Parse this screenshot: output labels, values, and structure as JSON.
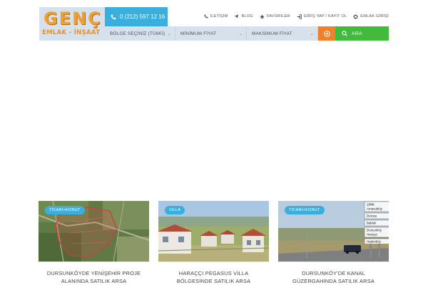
{
  "brand": {
    "logo_main": "GENÇ",
    "logo_sub": "EMLAK - İNŞAAT"
  },
  "header": {
    "phone": "0 (212) 597 12 16",
    "nav": [
      {
        "label": "İLETİŞİM",
        "icon": "phone-icon"
      },
      {
        "label": "BLOG",
        "icon": "send-icon"
      },
      {
        "label": "FAVORİLER",
        "icon": "star-icon"
      },
      {
        "label": "GİRİŞ YAP / KAYIT OL",
        "icon": "login-icon"
      },
      {
        "label": "EMLAK GİRİŞİ",
        "icon": "gear-icon"
      }
    ]
  },
  "search": {
    "region": "BÖLGE SEÇİNİZ (TÜMÜ)",
    "min_price": "MİNİMUM FİYAT",
    "max_price": "MAKSİMUM FİYAT",
    "button": "ARA"
  },
  "listings": [
    {
      "badge": "TİCARİ+KONUT",
      "title_line1": "DURSUNKÖYDE YENİŞEHİR PROJE",
      "title_line2": "ALANINDA SATILIK ARSA"
    },
    {
      "badge": "VİLLA",
      "title_line1": "HARAÇÇI PEGASUS VİLLA",
      "title_line2": "BÖLGESİNDE SATILIK ARSA"
    },
    {
      "badge": "TİCARİ+KONUT",
      "title_line1": "DURSUNKÖY'DE KANAL",
      "title_line2": "GÜZERGAHINDA SATILIK ARSA"
    }
  ],
  "sign": [
    "Çiftlik",
    "Arnavutköy",
    "Durusu",
    "Baklalı",
    "Dursunköy",
    "Haraççı",
    "Hadımköy"
  ],
  "colors": {
    "accent_blue": "#3aaedc",
    "orange": "#f0802a",
    "green": "#42bb3d",
    "search_bg": "#d7e1ec"
  }
}
